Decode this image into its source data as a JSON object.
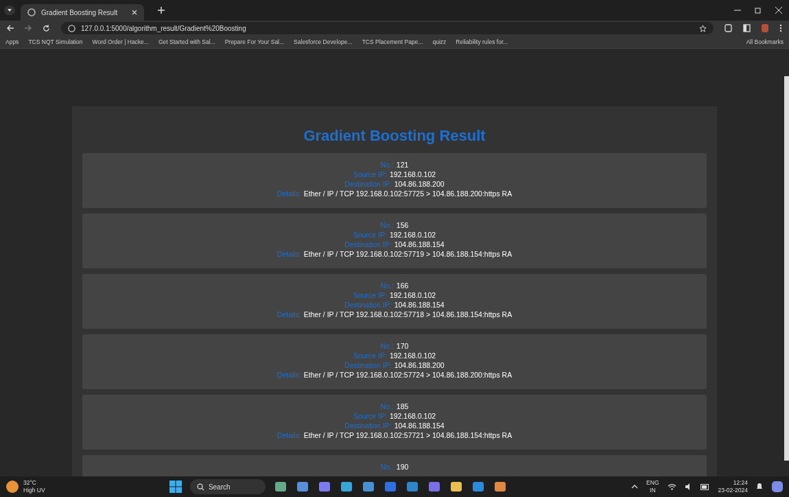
{
  "browser": {
    "tab": {
      "title": "Gradient Boosting Result"
    },
    "url": "127.0.0.1:5000/algorithm_result/Gradient%20Boosting",
    "bookmarks": [
      "Apps",
      "TCS NQT Simulation",
      "Word Order | Hacke...",
      "Get Started with Sal...",
      "Prepare For Your Sal...",
      "Salesforce Develope...",
      "TCS Placement Pape...",
      "quizz",
      "Reliability rules for..."
    ],
    "all_bookmarks": "All Bookmarks"
  },
  "page": {
    "title": "Gradient Boosting Result",
    "records": [
      {
        "fields": [
          {
            "label": "No.:",
            "value": "121"
          },
          {
            "label": "Source IP:",
            "value": "192.168.0.102"
          },
          {
            "label": "Destination IP:",
            "value": "104.86.188.200"
          },
          {
            "label": "Details:",
            "value": "Ether / IP / TCP 192.168.0.102:57725 > 104.86.188.200:https RA"
          }
        ]
      },
      {
        "fields": [
          {
            "label": "No.:",
            "value": "156"
          },
          {
            "label": "Source IP:",
            "value": "192.168.0.102"
          },
          {
            "label": "Destination IP:",
            "value": "104.86.188.154"
          },
          {
            "label": "Details:",
            "value": "Ether / IP / TCP 192.168.0.102:57719 > 104.86.188.154:https RA"
          }
        ]
      },
      {
        "fields": [
          {
            "label": "No.:",
            "value": "166"
          },
          {
            "label": "Source IP:",
            "value": "192.168.0.102"
          },
          {
            "label": "Destination IP:",
            "value": "104.86.188.154"
          },
          {
            "label": "Details:",
            "value": "Ether / IP / TCP 192.168.0.102:57718 > 104.86.188.154:https RA"
          }
        ]
      },
      {
        "fields": [
          {
            "label": "No.:",
            "value": "170"
          },
          {
            "label": "Source IP:",
            "value": "192.168.0.102"
          },
          {
            "label": "Destination IP:",
            "value": "104.86.188.200"
          },
          {
            "label": "Details:",
            "value": "Ether / IP / TCP 192.168.0.102:57724 > 104.86.188.200:https RA"
          }
        ]
      },
      {
        "fields": [
          {
            "label": "No.:",
            "value": "185"
          },
          {
            "label": "Source IP:",
            "value": "192.168.0.102"
          },
          {
            "label": "Destination IP:",
            "value": "104.86.188.154"
          },
          {
            "label": "Details:",
            "value": "Ether / IP / TCP 192.168.0.102:57721 > 104.86.188.154:https RA"
          }
        ]
      },
      {
        "fields": [
          {
            "label": "No.:",
            "value": "190"
          }
        ]
      }
    ]
  },
  "taskbar": {
    "weather": {
      "temp": "32°C",
      "condition": "High UV"
    },
    "search": {
      "placeholder": "Search"
    },
    "language": "ENG",
    "region": "IN",
    "time": "12:24",
    "date": "23-02-2024"
  }
}
